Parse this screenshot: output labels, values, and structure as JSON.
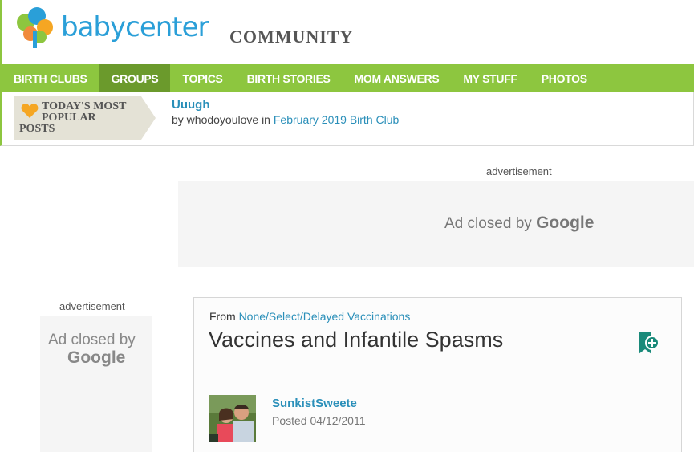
{
  "header": {
    "logo_text": "babycenter",
    "community": "COMMUNITY"
  },
  "nav": {
    "items": [
      {
        "label": "BIRTH CLUBS"
      },
      {
        "label": "GROUPS"
      },
      {
        "label": "TOPICS"
      },
      {
        "label": "BIRTH STORIES"
      },
      {
        "label": "MOM ANSWERS"
      },
      {
        "label": "MY STUFF"
      },
      {
        "label": "PHOTOS"
      }
    ],
    "active_item": "GROUPS"
  },
  "popular": {
    "badge_line1": "TODAY'S MOST",
    "badge_line2": "POPULAR",
    "badge_line3": "POSTS",
    "post_title": "Uuugh",
    "post_by": "by whodoyoulove in",
    "post_club": "February 2019 Birth Club"
  },
  "ads": {
    "label": "advertisement",
    "closed_text": "Ad closed by",
    "google": "Google"
  },
  "post": {
    "from_label": "From",
    "group": "None/Select/Delayed Vaccinations",
    "title": "Vaccines and Infantile Spasms",
    "author": "SunkistSweete",
    "posted": "Posted 04/12/2011"
  },
  "colors": {
    "brand_green": "#8dc63f",
    "active_green": "#6b9a2c",
    "link_blue": "#2a8fb9",
    "logo_blue": "#2a9fd8",
    "heart_orange": "#f5a623"
  }
}
